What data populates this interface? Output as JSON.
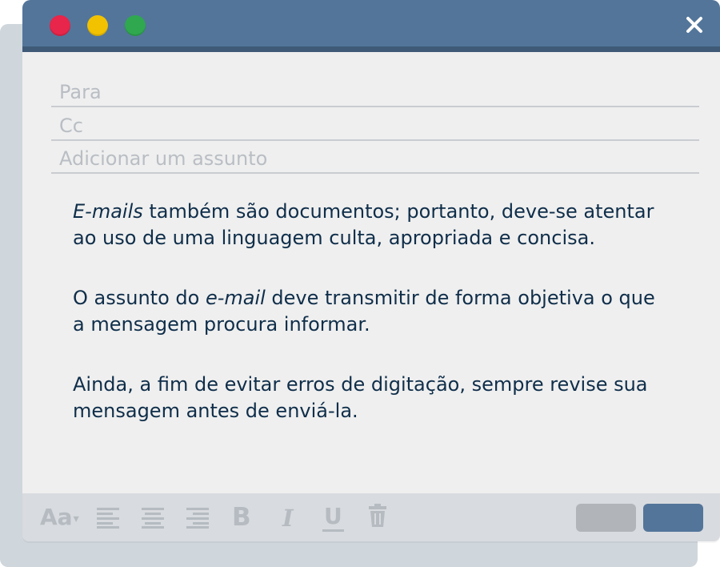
{
  "window": {
    "controls": [
      "close-dot-red",
      "minimize-dot-yellow",
      "maximize-dot-green"
    ],
    "close_icon": "close-icon",
    "colors": {
      "titlebar": "#53759a",
      "titlebar_border": "#3f5a77",
      "body": "#efefef",
      "toolbar": "#d8dbdf",
      "text": "#0f2e4a",
      "red": "#e8254a",
      "yellow": "#f2c200",
      "green": "#2fa84f"
    }
  },
  "fields": {
    "to_placeholder": "Para",
    "cc_placeholder": "Cc",
    "subject_placeholder": "Adicionar um assunto"
  },
  "message": {
    "p1_em": "E-mails",
    "p1_rest": " também são documentos; portanto, deve-se atentar ao uso de uma linguagem culta, apropriada e concisa.",
    "p2_start": "O assunto do ",
    "p2_em": "e-mail",
    "p2_rest": " deve transmitir de forma objetiva o que a mensagem procura informar.",
    "p3": "Ainda, a fim de evitar erros de digitação, sempre revise sua mensagem antes de enviá-la."
  },
  "toolbar": {
    "font_size_label": "Aa",
    "font_size_caret": "▾",
    "bold_label": "B",
    "italic_label": "I",
    "underline_label": "U",
    "icons": [
      "align-left-icon",
      "align-center-icon",
      "align-right-icon",
      "trash-icon"
    ]
  }
}
